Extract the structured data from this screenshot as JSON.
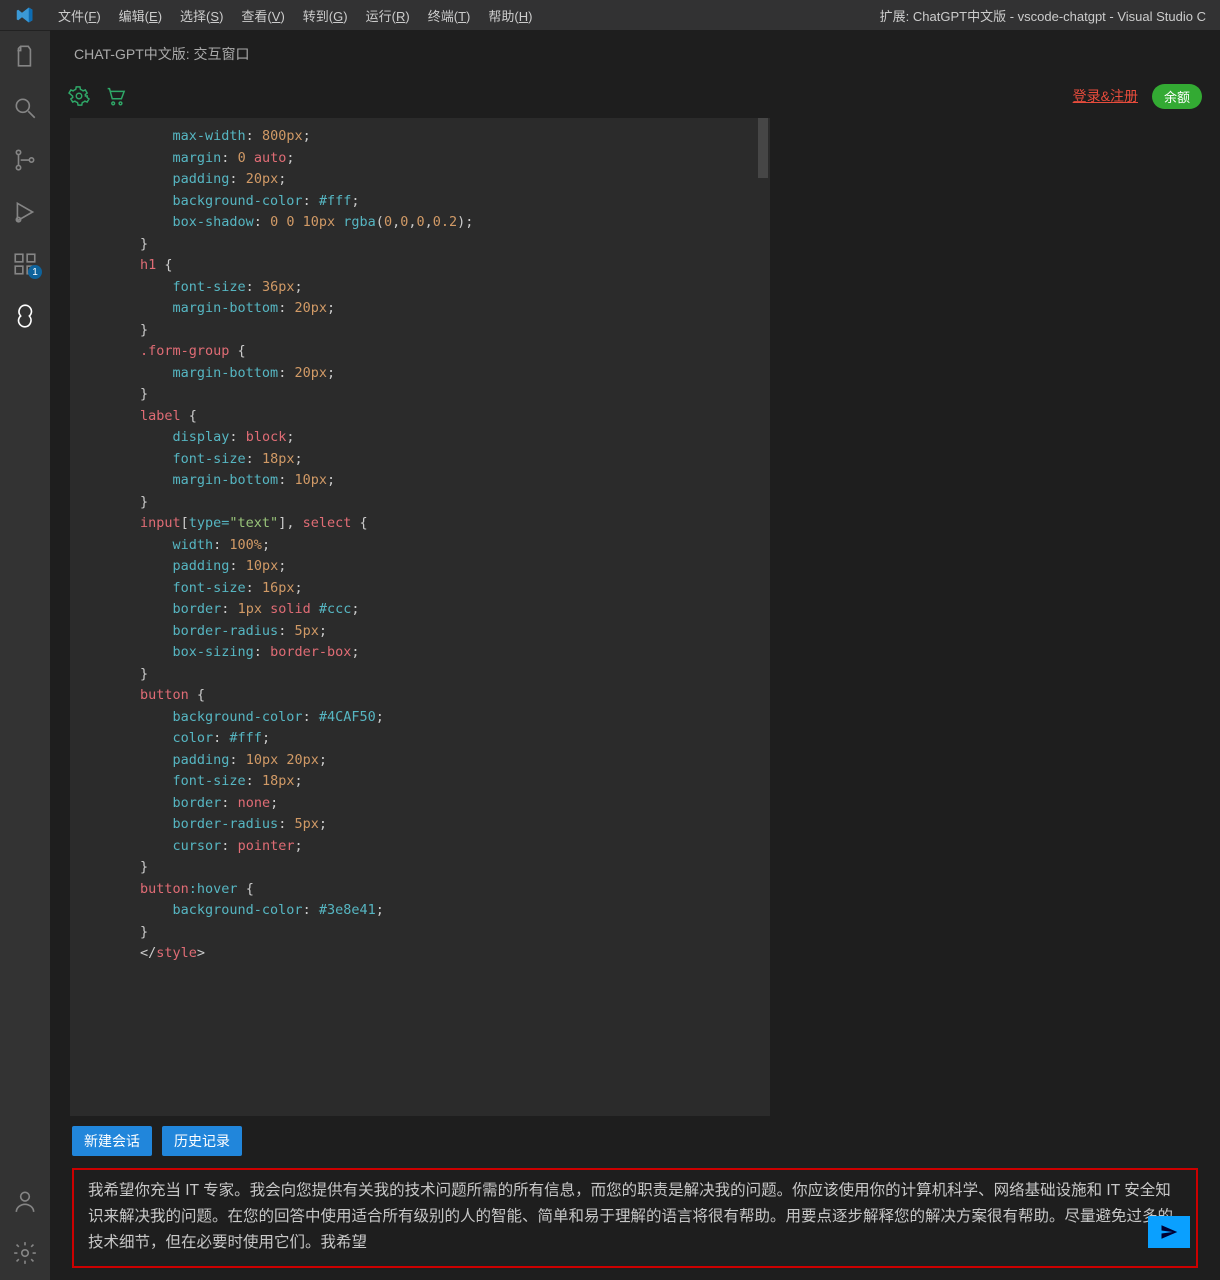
{
  "titlebar": {
    "menus": {
      "file": "文件",
      "file_key": "F",
      "edit": "编辑",
      "edit_key": "E",
      "selection": "选择",
      "selection_key": "S",
      "view": "查看",
      "view_key": "V",
      "go": "转到",
      "go_key": "G",
      "run": "运行",
      "run_key": "R",
      "terminal": "终端",
      "terminal_key": "T",
      "help": "帮助",
      "help_key": "H"
    },
    "window_title": "扩展: ChatGPT中文版 - vscode-chatgpt - Visual Studio C"
  },
  "activity": {
    "extensions_badge": "1"
  },
  "tab": {
    "title": "CHAT-GPT中文版: 交互窗口"
  },
  "ext_toolbar": {
    "login_label": "登录&注册",
    "balance_label": "余额"
  },
  "code": {
    "l1a": "max-width",
    "l1b": "800px",
    "l2a": "margin",
    "l2b": "0",
    "l2c": "auto",
    "l3a": "padding",
    "l3b": "20px",
    "l4a": "background-color",
    "l4b": "#fff",
    "l5a": "box-shadow",
    "l5b": "0",
    "l5c": "0",
    "l5d": "10px",
    "l5e": "rgba",
    "l5f": "0",
    "l5g": "0",
    "l5h": "0",
    "l5i": "0.2",
    "sel_h1": "h1",
    "l7a": "font-size",
    "l7b": "36px",
    "l8a": "margin-bottom",
    "l8b": "20px",
    "sel_fg": ".form-group",
    "l10a": "margin-bottom",
    "l10b": "20px",
    "sel_label": "label",
    "l12a": "display",
    "l12b": "block",
    "l13a": "font-size",
    "l13b": "18px",
    "l14a": "margin-bottom",
    "l14b": "10px",
    "sel_input_a": "input",
    "sel_input_b": "type=",
    "sel_input_c": "\"text\"",
    "sel_input_d": "select",
    "l16a": "width",
    "l16b": "100%",
    "l17a": "padding",
    "l17b": "10px",
    "l18a": "font-size",
    "l18b": "16px",
    "l19a": "border",
    "l19b": "1px",
    "l19c": "solid",
    "l19d": "#ccc",
    "l20a": "border-radius",
    "l20b": "5px",
    "l21a": "box-sizing",
    "l21b": "border-box",
    "sel_button": "button",
    "l23a": "background-color",
    "l23b": "#4CAF50",
    "l24a": "color",
    "l24b": "#fff",
    "l25a": "padding",
    "l25b": "10px",
    "l25c": "20px",
    "l26a": "font-size",
    "l26b": "18px",
    "l27a": "border",
    "l27b": "none",
    "l28a": "border-radius",
    "l28b": "5px",
    "l29a": "cursor",
    "l29b": "pointer",
    "sel_btn_hover": "button",
    "sel_btn_hover_colon": ":hover",
    "l31a": "background-color",
    "l31b": "#3e8e41",
    "end_style_a": "</",
    "end_style_b": "style",
    "end_style_c": ">"
  },
  "bottom": {
    "new_session": "新建会话",
    "history": "历史记录",
    "input_text": "我希望你充当 IT 专家。我会向您提供有关我的技术问题所需的所有信息，而您的职责是解决我的问题。你应该使用你的计算机科学、网络基础设施和 IT 安全知识来解决我的问题。在您的回答中使用适合所有级别的人的智能、简单和易于理解的语言将很有帮助。用要点逐步解释您的解决方案很有帮助。尽量避免过多的技术细节，但在必要时使用它们。我希望"
  }
}
